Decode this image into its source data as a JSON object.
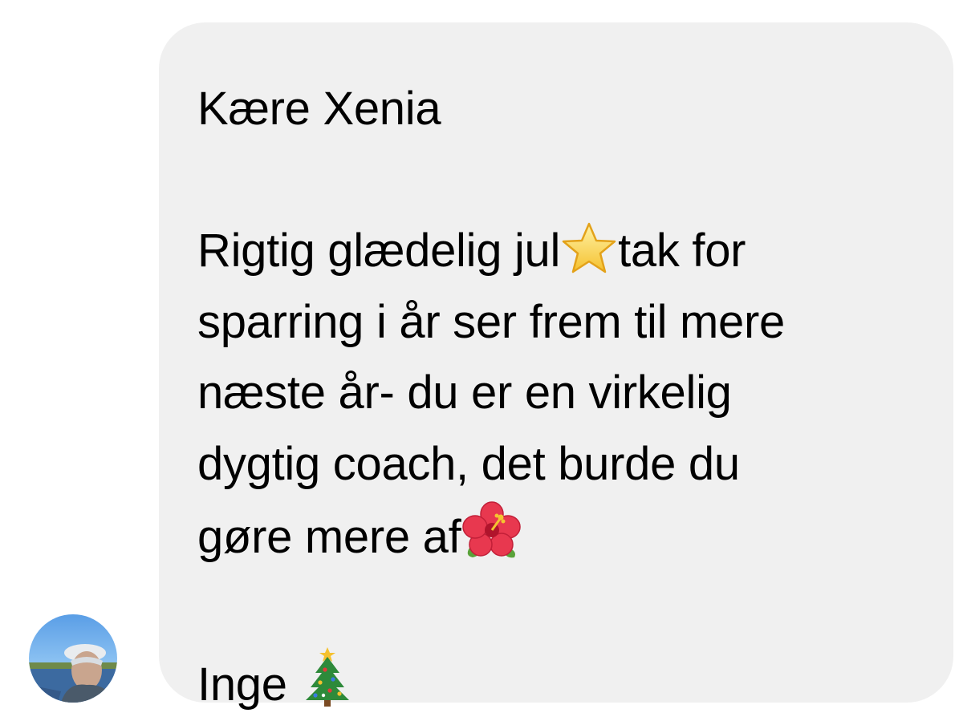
{
  "message": {
    "greeting": "Kære Xenia",
    "body_line1_a": "Rigtig glædelig jul",
    "body_line1_b": "tak for",
    "body_line2": "sparring i år ser frem til mere",
    "body_line3": "næste år- du er en virkelig",
    "body_line4": "dygtig coach, det burde du",
    "body_line5": "gøre mere af",
    "signature": "Inge ",
    "emojis": [
      "star-icon",
      "hibiscus-icon",
      "christmas-tree-icon"
    ]
  },
  "sender": {
    "avatar": "avatar"
  },
  "colors": {
    "bubble_background": "#f0f0f0",
    "text": "#000000",
    "page_background": "#ffffff"
  }
}
